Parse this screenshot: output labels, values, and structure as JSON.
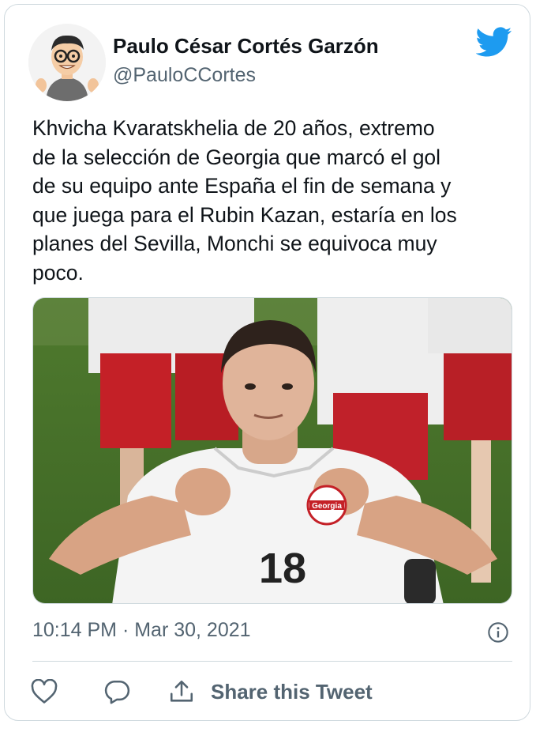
{
  "tweet": {
    "author": {
      "name": "Paulo César Cortés Garzón",
      "handle": "@PauloCCortes"
    },
    "text": "Khvicha Kvaratskhelia de 20 años, extremo\nde la selección de Georgia que marcó el gol\nde su equipo ante España el fin de semana y\nque juega para el Rubin Kazan, estaría en los\nplanes del Sevilla, Monchi se equivoca muy\npoco.",
    "photo": {
      "jersey_number": "18",
      "badge_text": "Georgia"
    },
    "timestamp": "10:14 PM · Mar 30, 2021"
  },
  "actions": {
    "share_label": "Share this Tweet"
  },
  "icons": {
    "brand": "twitter-bird-icon",
    "info": "info-icon",
    "like": "heart-icon",
    "reply": "reply-bubble-icon",
    "share": "share-upload-icon"
  },
  "colors": {
    "twitter_blue": "#1d9bf0",
    "text_primary": "#0f1419",
    "text_secondary": "#536471",
    "border": "#cfd9de"
  }
}
